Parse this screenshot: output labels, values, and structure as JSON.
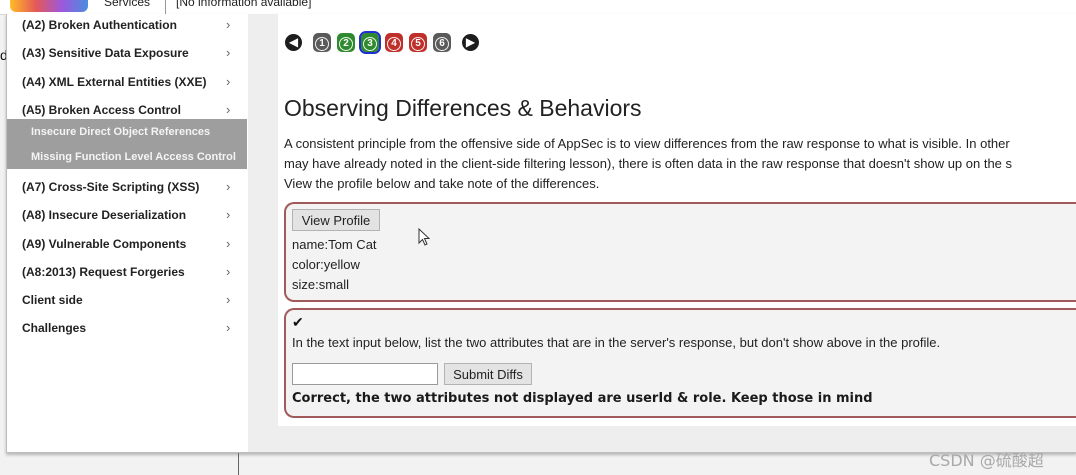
{
  "topbar": {
    "services": "Services",
    "info": "[No information available]"
  },
  "stub_text": "d",
  "sidebar": {
    "items": [
      {
        "label": "(A2) Broken Authentication",
        "chevron": "›"
      },
      {
        "label": "(A3) Sensitive Data Exposure",
        "chevron": "›"
      },
      {
        "label": "(A4) XML External Entities (XXE)",
        "chevron": "›"
      },
      {
        "label": "(A5) Broken Access Control",
        "chevron": "›"
      },
      {
        "label": "(A7) Cross-Site Scripting (XSS)",
        "chevron": "›"
      },
      {
        "label": "(A8) Insecure Deserialization",
        "chevron": "›"
      },
      {
        "label": "(A9) Vulnerable Components",
        "chevron": "›"
      },
      {
        "label": "(A8:2013) Request Forgeries",
        "chevron": "›"
      },
      {
        "label": "Client side",
        "chevron": "›"
      },
      {
        "label": "Challenges",
        "chevron": "›"
      }
    ],
    "subitems": [
      {
        "label": "Insecure Direct Object References"
      },
      {
        "label": "Missing Function Level Access Control"
      }
    ]
  },
  "lesson_nav": {
    "prev_icon": "arrow-left-icon",
    "next_icon": "arrow-right-icon",
    "prev_glyph": "◀",
    "next_glyph": "▶",
    "pages": [
      {
        "label": "1",
        "color": "#5a5a5a",
        "active": false
      },
      {
        "label": "2",
        "color": "#2f8a2f",
        "active": false
      },
      {
        "label": "3",
        "color": "#2f8a2f",
        "active": true
      },
      {
        "label": "4",
        "color": "#c0302a",
        "active": false
      },
      {
        "label": "5",
        "color": "#c0302a",
        "active": false
      },
      {
        "label": "6",
        "color": "#5a5a5a",
        "active": false
      }
    ]
  },
  "lesson": {
    "title": "Observing Differences & Behaviors",
    "paragraph_lines": [
      "A consistent principle from the offensive side of AppSec is to view differences from the raw response to what is visible. In other",
      "may have already noted in the client-side filtering lesson), there is often data in the raw response that doesn't show up on the s",
      "View the profile below and take note of the differences."
    ]
  },
  "profile_panel": {
    "button_label": "View Profile",
    "lines": [
      "name:Tom Cat",
      "color:yellow",
      "size:small"
    ]
  },
  "attack_panel": {
    "check": "✔",
    "instruction": "In the text input below, list the two attributes that are in the server's response, but don't show above in the profile.",
    "input_value": "",
    "submit_label": "Submit Diffs",
    "feedback": "Correct, the two attributes not displayed are userId & role. Keep those in mind"
  },
  "watermark": "CSDN @硫酸超",
  "colors": {
    "panel_border": "#a05a5a",
    "submenu_bg": "#9e9e9e",
    "active_outline": "#1f2fd0"
  }
}
